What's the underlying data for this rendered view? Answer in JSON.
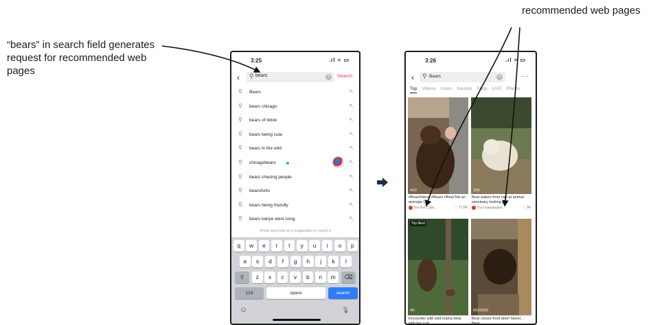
{
  "annotations": {
    "left": "“bears” in search field generates request for recommended web pages",
    "right": "recommended web pages"
  },
  "phone1": {
    "status_time": "3:25",
    "search_value": "bears",
    "search_button": "Search",
    "suggestions": [
      {
        "text": "Bears"
      },
      {
        "text": "bears chicago"
      },
      {
        "text": "bears of tiktok"
      },
      {
        "text": "bears being cute"
      },
      {
        "text": "bears in the wild"
      },
      {
        "text": "chicagobears",
        "verified": true
      },
      {
        "text": "bears chasing people"
      },
      {
        "text": "bearsforlix"
      },
      {
        "text": "bears being friendly"
      },
      {
        "text": "bears kanye west song"
      }
    ],
    "report_hint": "Press and hold on a suggestion to report it",
    "keyboard": {
      "row1": [
        "q",
        "w",
        "e",
        "r",
        "t",
        "y",
        "u",
        "i",
        "o",
        "p"
      ],
      "row2": [
        "a",
        "s",
        "d",
        "f",
        "g",
        "h",
        "j",
        "k",
        "l"
      ],
      "row3": [
        "z",
        "x",
        "c",
        "v",
        "b",
        "n",
        "m"
      ],
      "numbers_key": "123",
      "space_key": "space",
      "search_key": "search"
    }
  },
  "phone2": {
    "status_time": "3:26",
    "search_value": "Bears",
    "tabs": [
      "Top",
      "Videos",
      "Users",
      "Sounds",
      "Shop",
      "LIVE",
      "Places"
    ],
    "results": [
      {
        "caption": "#BearVideos #Bears #BearTok an average Chi...",
        "author": "The Pet Colle...",
        "likes": "71.6K",
        "overlay": "4/10"
      },
      {
        "caption": "Bear wakes from nap at animal sanctuary looking p...",
        "author": "The Independent",
        "likes": "9K",
        "overlay": "3/16"
      },
      {
        "caption": "Encounter with wild mama bear with her cub",
        "author": "",
        "likes": "",
        "overlay": "4/5",
        "badge": "Top liked"
      },
      {
        "caption": "Bear closes front door! Never... Bear...",
        "author": "",
        "likes": "",
        "overlay": "6/10/2022"
      }
    ]
  },
  "colors": {
    "accent_red": "#e23b53",
    "keyboard_blue": "#2f7cf6",
    "keyboard_bg": "#d1d3d9"
  }
}
